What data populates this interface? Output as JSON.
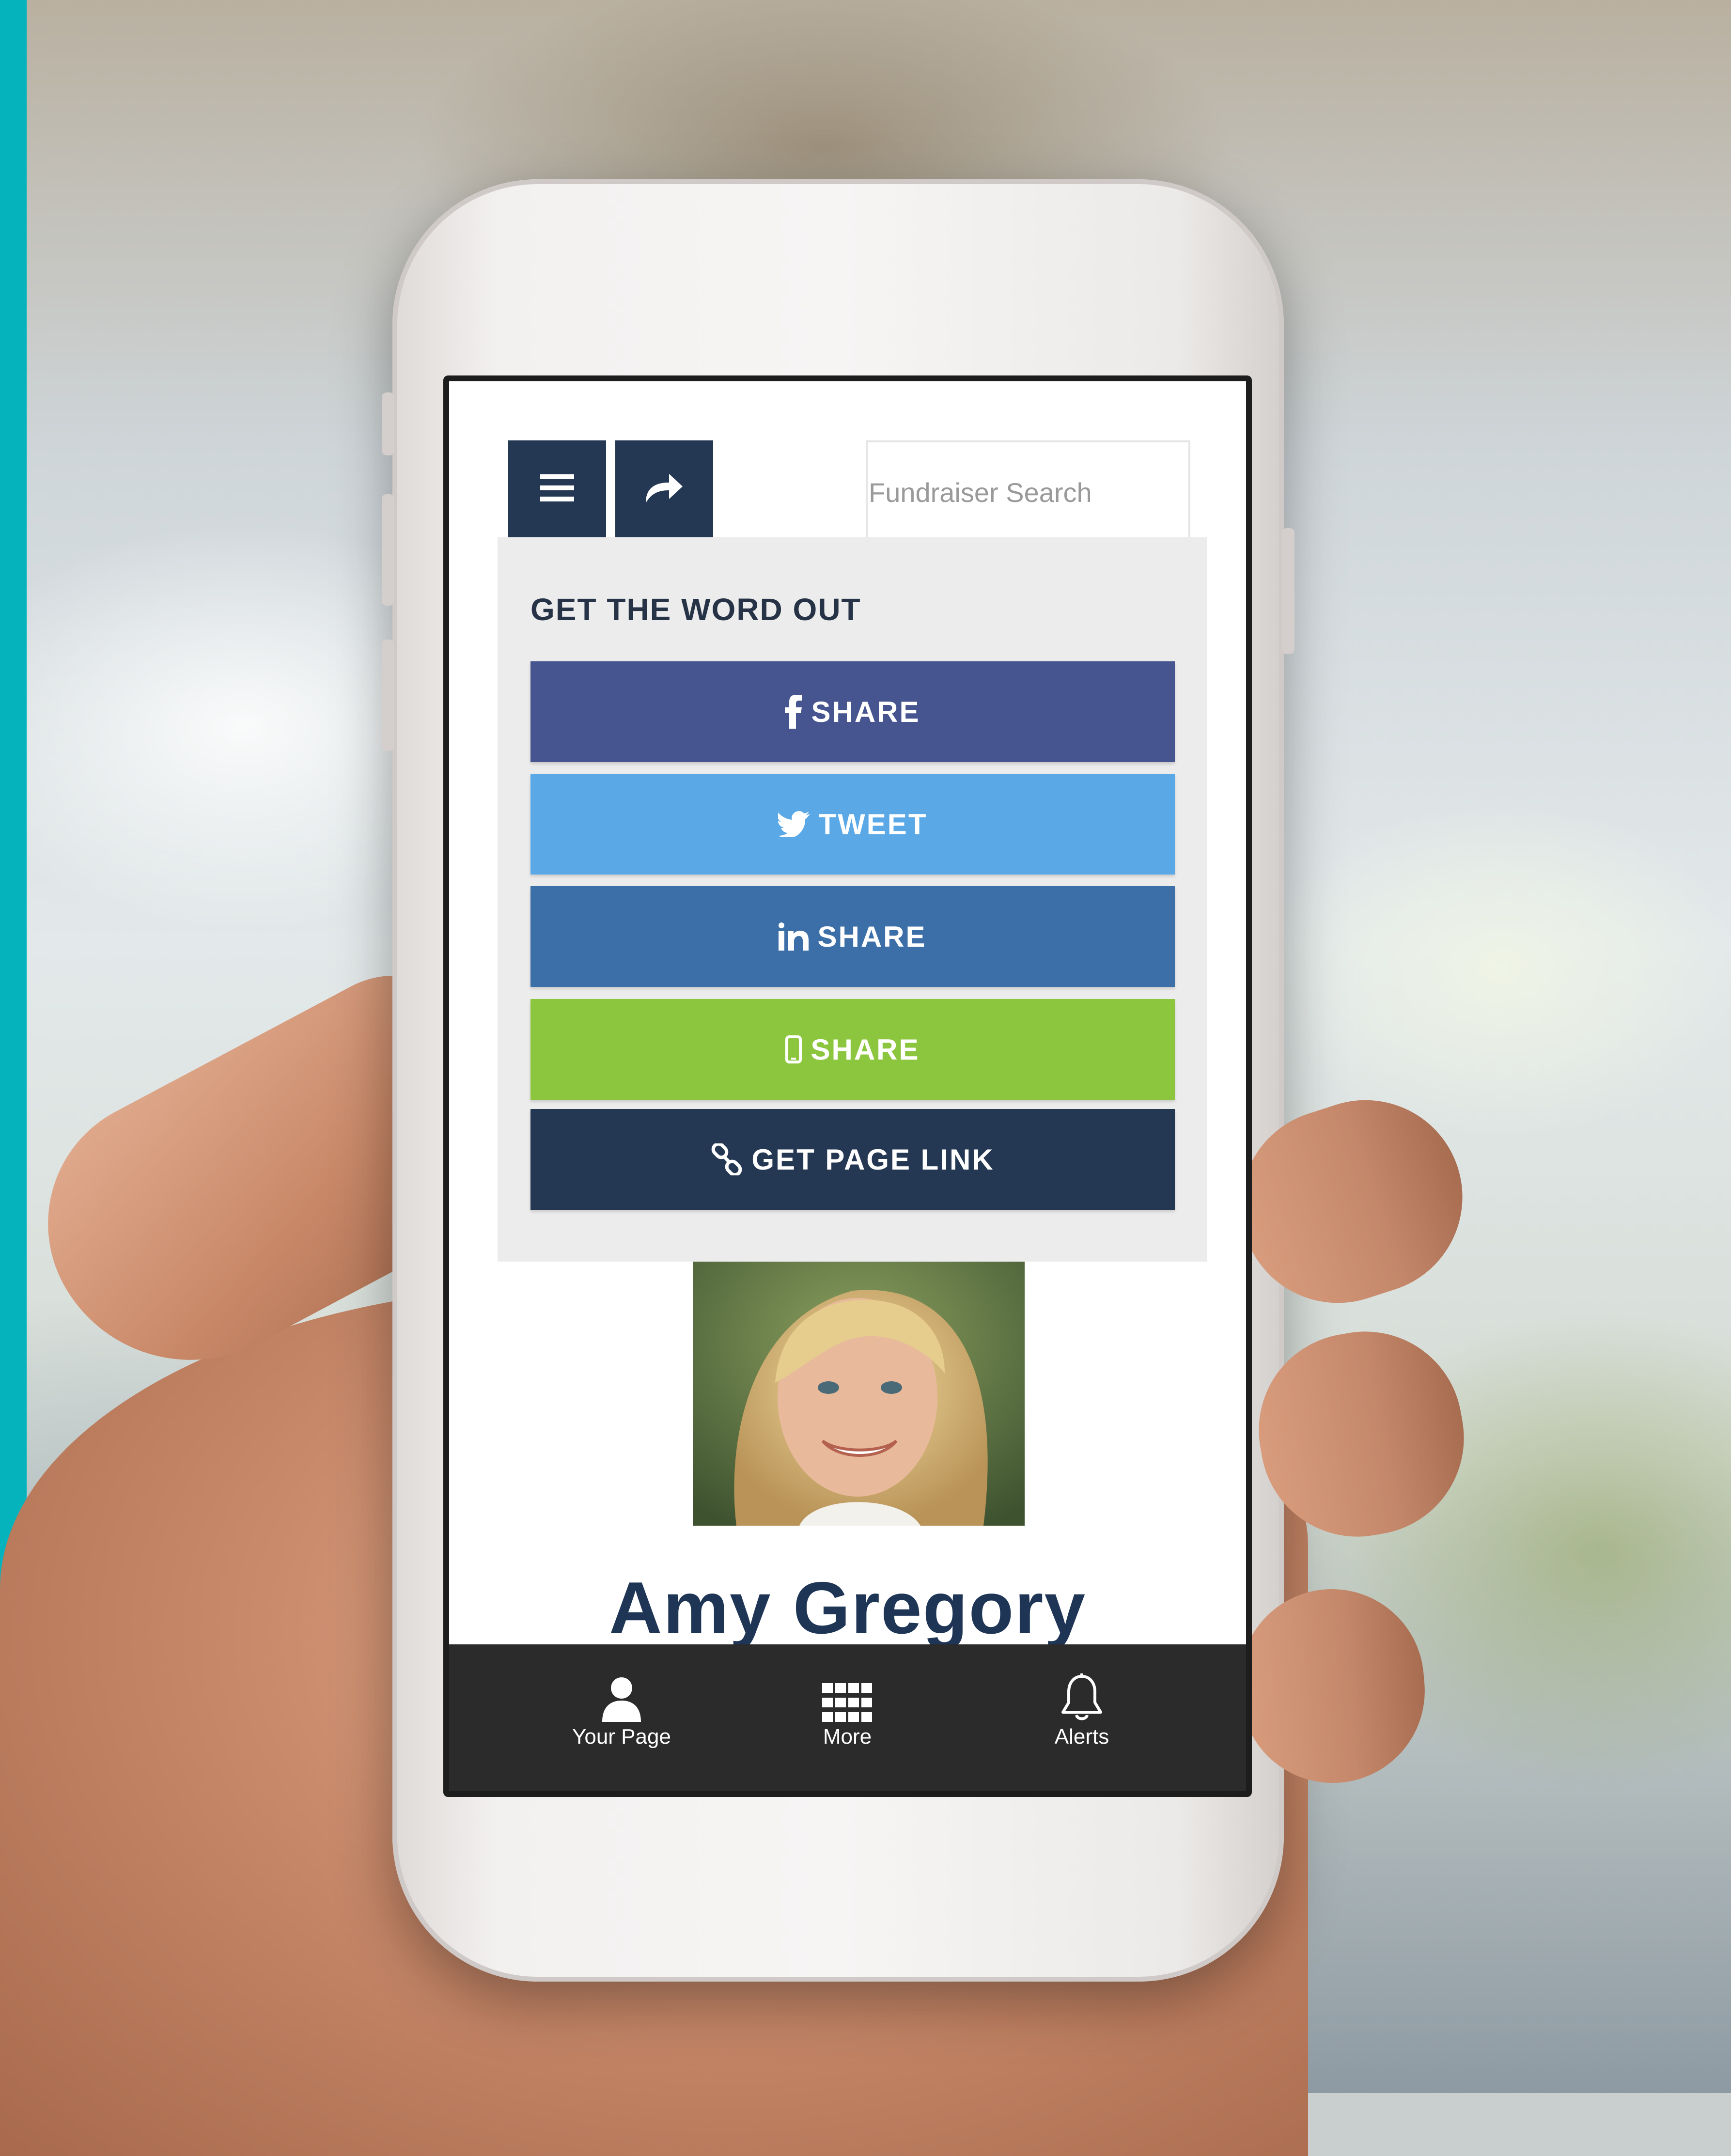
{
  "header": {
    "search_placeholder": "Fundraiser Search"
  },
  "share_panel": {
    "title": "GET THE WORD OUT",
    "buttons": [
      {
        "icon": "facebook-icon",
        "label": "SHARE",
        "color": "#465590"
      },
      {
        "icon": "twitter-icon",
        "label": "TWEET",
        "color": "#5aa8e6"
      },
      {
        "icon": "linkedin-icon",
        "label": "SHARE",
        "color": "#3c6ea8"
      },
      {
        "icon": "mobile-phone-icon",
        "label": "SHARE",
        "color": "#8cc63e"
      },
      {
        "icon": "link-icon",
        "label": "GET PAGE LINK",
        "color": "#243753"
      }
    ]
  },
  "profile": {
    "name": "Amy Gregory"
  },
  "tab_bar": {
    "items": [
      {
        "icon": "user-icon",
        "label": "Your Page"
      },
      {
        "icon": "grid-icon",
        "label": "More"
      },
      {
        "icon": "bell-icon",
        "label": "Alerts"
      }
    ]
  },
  "colors": {
    "navy": "#243753",
    "accent_teal": "#05b3bd"
  }
}
